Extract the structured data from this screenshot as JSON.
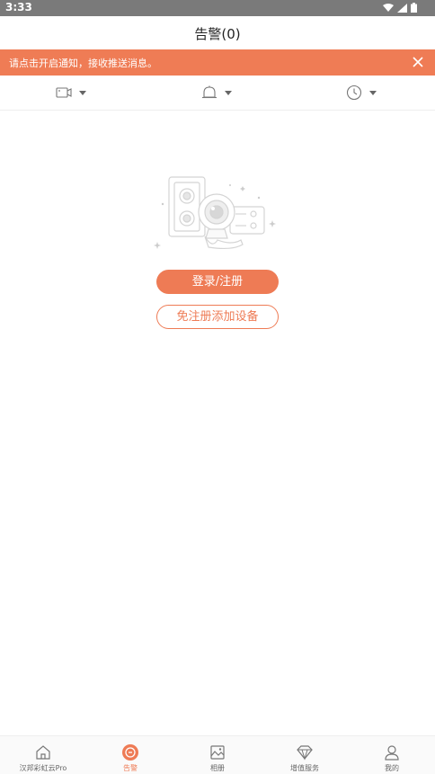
{
  "statusbar": {
    "time": "3:33"
  },
  "header": {
    "title": "告警(0)"
  },
  "banner": {
    "message": "请点击开启通知，接收推送消息。"
  },
  "filters": [
    {
      "icon": "camera-icon"
    },
    {
      "icon": "bell-icon"
    },
    {
      "icon": "clock-icon"
    }
  ],
  "empty_state": {
    "login_button": "登录/注册",
    "add_device_button": "免注册添加设备"
  },
  "tabs": [
    {
      "label": "汉邦彩虹云Pro",
      "icon": "home-icon"
    },
    {
      "label": "告警",
      "icon": "alarm-icon",
      "active": true
    },
    {
      "label": "相册",
      "icon": "album-icon"
    },
    {
      "label": "增值服务",
      "icon": "diamond-icon"
    },
    {
      "label": "我的",
      "icon": "profile-icon"
    }
  ],
  "colors": {
    "accent": "#ee7b55",
    "banner": "#ef7c55",
    "statusbar": "#7a7a7a"
  }
}
